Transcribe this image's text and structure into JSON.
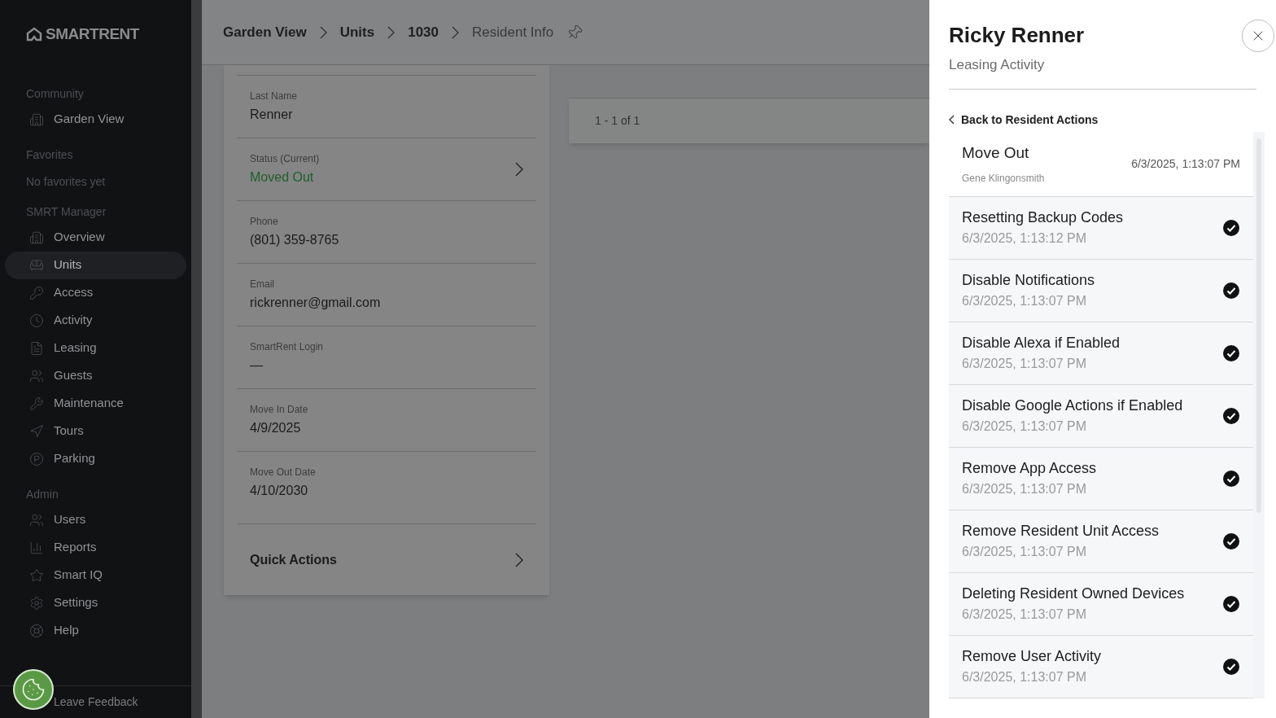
{
  "sidebar": {
    "logo": "SMARTRENT",
    "sections": [
      {
        "title": "Community",
        "items": [
          {
            "label": "Garden View",
            "selected": false
          }
        ]
      },
      {
        "title": "Favorites",
        "empty_text": "No favorites yet"
      },
      {
        "title": "SMRT Manager",
        "items": [
          {
            "label": "Overview",
            "selected": false
          },
          {
            "label": "Units",
            "selected": true
          },
          {
            "label": "Access",
            "selected": false
          },
          {
            "label": "Activity",
            "selected": false
          },
          {
            "label": "Leasing",
            "selected": false
          },
          {
            "label": "Guests",
            "selected": false
          },
          {
            "label": "Maintenance",
            "selected": false
          },
          {
            "label": "Tours",
            "selected": false
          },
          {
            "label": "Parking",
            "selected": false
          }
        ]
      },
      {
        "title": "Admin",
        "items": [
          {
            "label": "Users",
            "selected": false
          },
          {
            "label": "Reports",
            "selected": false
          },
          {
            "label": "Smart IQ",
            "selected": false
          },
          {
            "label": "Settings",
            "selected": false
          },
          {
            "label": "Help",
            "selected": false
          }
        ]
      }
    ],
    "feedback": "Leave Feedback"
  },
  "breadcrumb": [
    {
      "label": "Garden View",
      "current": false
    },
    {
      "label": "Units",
      "current": false
    },
    {
      "label": "1030",
      "current": false
    },
    {
      "label": "Resident Info",
      "current": true
    }
  ],
  "fields": [
    {
      "label": "Last Name",
      "value": "Renner",
      "kind": "text"
    },
    {
      "label": "Status (Current)",
      "value": "Moved Out",
      "kind": "status"
    },
    {
      "label": "Phone",
      "value": "(801) 359-8765",
      "kind": "text"
    },
    {
      "label": "Email",
      "value": "rickrenner@gmail.com",
      "kind": "text"
    },
    {
      "label": "SmartRent Login",
      "value": "—",
      "kind": "text"
    },
    {
      "label": "Move In Date",
      "value": "4/9/2025",
      "kind": "text"
    },
    {
      "label": "Move Out Date",
      "value": "4/10/2030",
      "kind": "text"
    }
  ],
  "quick_actions": "Quick Actions",
  "pagination": "1 - 1 of 1",
  "panel": {
    "title": "Ricky Renner",
    "subtitle": "Leasing Activity",
    "back": "Back to Resident Actions",
    "event": {
      "title": "Move Out",
      "by": "Gene Klingonsmith",
      "time": "6/3/2025, 1:13:07 PM"
    },
    "steps": [
      {
        "title": "Resetting Backup Codes",
        "time": "6/3/2025, 1:13:12 PM",
        "done": true
      },
      {
        "title": "Disable Notifications",
        "time": "6/3/2025, 1:13:07 PM",
        "done": true
      },
      {
        "title": "Disable Alexa if Enabled",
        "time": "6/3/2025, 1:13:07 PM",
        "done": true
      },
      {
        "title": "Disable Google Actions if Enabled",
        "time": "6/3/2025, 1:13:07 PM",
        "done": true
      },
      {
        "title": "Remove App Access",
        "time": "6/3/2025, 1:13:07 PM",
        "done": true
      },
      {
        "title": "Remove Resident Unit Access",
        "time": "6/3/2025, 1:13:07 PM",
        "done": true
      },
      {
        "title": "Deleting Resident Owned Devices",
        "time": "6/3/2025, 1:13:07 PM",
        "done": true
      },
      {
        "title": "Remove User Activity",
        "time": "6/3/2025, 1:13:07 PM",
        "done": true
      }
    ]
  }
}
